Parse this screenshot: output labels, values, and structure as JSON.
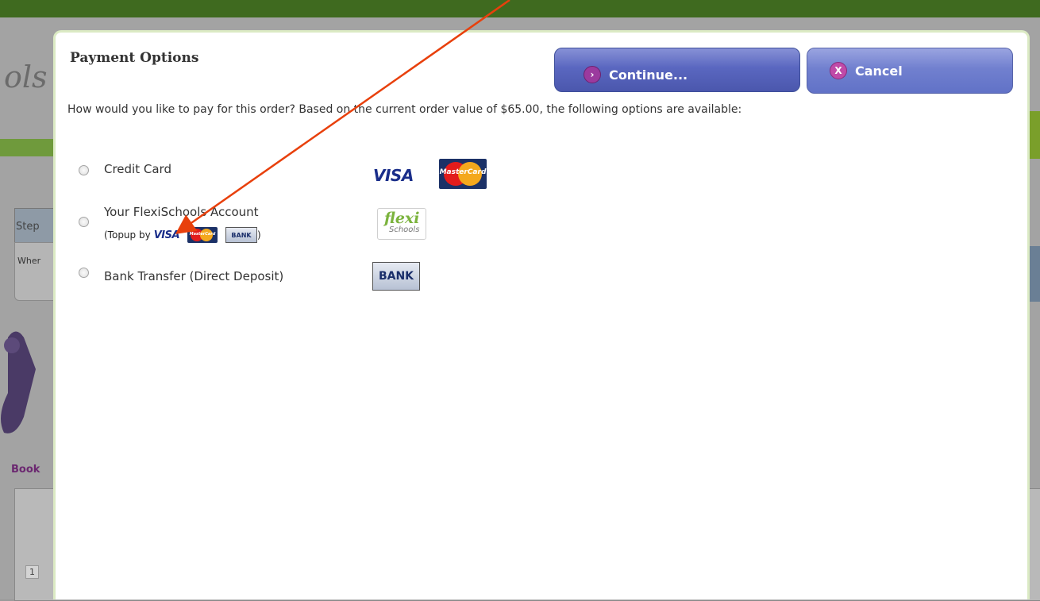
{
  "background": {
    "logo_fragment": "ols",
    "step_text": "Step",
    "where_text": "Wher",
    "book_text": "Book",
    "row_index": "1"
  },
  "modal": {
    "title": "Payment Options",
    "continue_label": "Continue...",
    "cancel_label": "Cancel",
    "intro": "How would you like to pay for this order? Based on the current order value of $65.00, the following options are available:",
    "options": [
      {
        "label": "Credit Card"
      },
      {
        "label": "Your FlexiSchools Account",
        "sublabel_prefix": "(Topup by",
        "sublabel_suffix": ")"
      },
      {
        "label": "Bank Transfer (Direct Deposit)"
      }
    ],
    "logos": {
      "visa": "VISA",
      "mastercard": "MasterCard",
      "bank": "BANK",
      "flexi_main": "flexi",
      "flexi_sub": "Schools"
    }
  },
  "colors": {
    "annotation_arrow": "#e8400c",
    "button_blue": "#5a67c0",
    "modal_border": "#dbeac4"
  }
}
